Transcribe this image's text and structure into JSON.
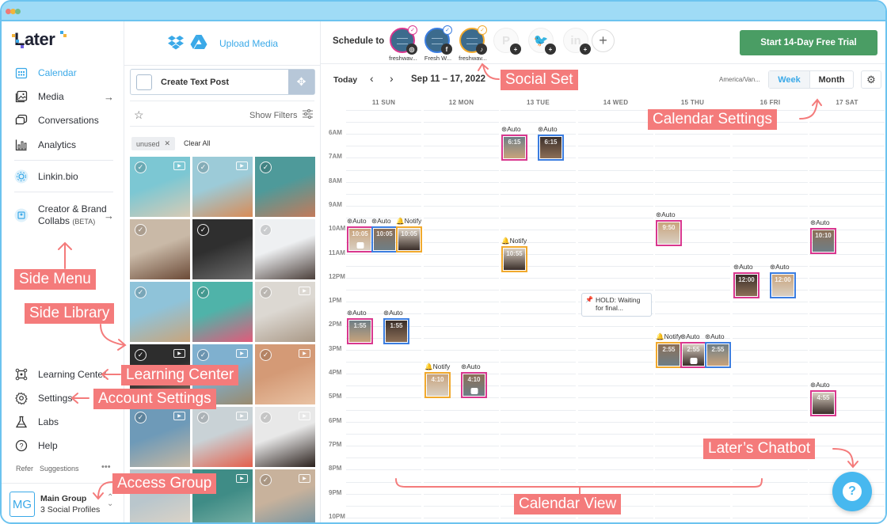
{
  "app": {
    "logo_text": "Later"
  },
  "sidebar": {
    "items": [
      {
        "label": "Calendar",
        "icon": "calendar-icon",
        "active": true
      },
      {
        "label": "Media",
        "icon": "media-icon",
        "arrow": "→"
      },
      {
        "label": "Conversations",
        "icon": "conversations-icon"
      },
      {
        "label": "Analytics",
        "icon": "analytics-icon"
      },
      {
        "label": "Linkin.bio",
        "icon": "linkinbio-icon"
      },
      {
        "label": "Creator & Brand",
        "label2": "Collabs",
        "badge": "(BETA)",
        "icon": "collabs-icon",
        "arrow": "→"
      }
    ],
    "bottom_items": [
      {
        "label": "Learning Center",
        "icon": "learning-center-icon"
      },
      {
        "label": "Settings",
        "icon": "settings-icon"
      },
      {
        "label": "Labs",
        "icon": "labs-icon"
      },
      {
        "label": "Help",
        "icon": "help-icon"
      }
    ],
    "refer": "Refer",
    "suggestions": "Suggestions",
    "more": "•••",
    "group": {
      "initials": "MG",
      "name": "Main Group",
      "profiles": "3 Social Profiles"
    }
  },
  "library": {
    "upload_label": "Upload Media",
    "create_text_post": "Create Text Post",
    "show_filters": "Show Filters",
    "filter_chip": "unused",
    "clear_all": "Clear All",
    "thumbnails": [
      {
        "video": true,
        "colors": [
          "#7cc7d3",
          "#d8cbb5"
        ]
      },
      {
        "video": true,
        "colors": [
          "#9ccbd8",
          "#d98b56"
        ]
      },
      {
        "video": false,
        "colors": [
          "#4e9a9a",
          "#c47a5a"
        ]
      },
      {
        "video": false,
        "colors": [
          "#c9b9a7",
          "#6b4a37"
        ]
      },
      {
        "video": false,
        "colors": [
          "#2f2f2f",
          "#6d6d6d"
        ]
      },
      {
        "video": false,
        "colors": [
          "#eef0f2",
          "#4b3f3a"
        ]
      },
      {
        "video": false,
        "colors": [
          "#8fc3d9",
          "#c9a57c"
        ]
      },
      {
        "video": false,
        "colors": [
          "#4fb3a9",
          "#e25a7a"
        ]
      },
      {
        "video": true,
        "colors": [
          "#dcd8d2",
          "#a99886"
        ]
      },
      {
        "video": true,
        "colors": [
          "#2d2d2d",
          "#8c7566"
        ]
      },
      {
        "video": true,
        "colors": [
          "#7fb0cf",
          "#9a8a6d"
        ]
      },
      {
        "video": true,
        "colors": [
          "#d49a76",
          "#e9c2a3"
        ]
      },
      {
        "video": true,
        "colors": [
          "#6e9ab8",
          "#c5b7a3"
        ]
      },
      {
        "video": true,
        "colors": [
          "#c9d2d6",
          "#e45f4b"
        ]
      },
      {
        "video": true,
        "colors": [
          "#e8e8e8",
          "#2a201c"
        ]
      },
      {
        "video": true,
        "colors": [
          "#b9c6cc",
          "#e0d5c6"
        ]
      },
      {
        "video": true,
        "colors": [
          "#3f8c86",
          "#7fb4a7"
        ]
      },
      {
        "video": true,
        "colors": [
          "#c8b29c",
          "#6a8fa0"
        ]
      }
    ]
  },
  "topbar": {
    "schedule_to": "Schedule to",
    "profiles": [
      {
        "name": "freshwav...",
        "network": "instagram",
        "color": "#d9378e",
        "connected": true
      },
      {
        "name": "Fresh W...",
        "network": "facebook",
        "color": "#3b7de0",
        "connected": true
      },
      {
        "name": "freshwav...",
        "network": "tiktok",
        "color": "#f1a92d",
        "connected": true
      },
      {
        "name": "",
        "network": "pinterest",
        "connected": false
      },
      {
        "name": "",
        "network": "twitter",
        "connected": false
      },
      {
        "name": "",
        "network": "linkedin",
        "connected": false
      }
    ],
    "trial_button": "Start 14-Day Free Trial"
  },
  "calendar": {
    "today": "Today",
    "range": "Sep 11 – 17, 2022",
    "timezone": "America/Van...",
    "view_week": "Week",
    "view_month": "Month",
    "active_view": "Week",
    "days": [
      "11 SUN",
      "12 MON",
      "13 TUE",
      "14 WED",
      "15 THU",
      "16 FRI",
      "17 SAT"
    ],
    "hours": [
      "6AM",
      "7AM",
      "8AM",
      "9AM",
      "10AM",
      "11AM",
      "12PM",
      "1PM",
      "2PM",
      "3PM",
      "4PM",
      "5PM",
      "6PM",
      "7PM",
      "8PM",
      "9PM",
      "10PM"
    ],
    "events": [
      {
        "day": 0,
        "time": "10:05",
        "mode": "Auto",
        "network": "instagram",
        "reel": true
      },
      {
        "day": 0,
        "time": "10:05",
        "mode": "Auto",
        "network": "facebook"
      },
      {
        "day": 0,
        "time": "10:05",
        "mode": "Notify",
        "network": "tiktok"
      },
      {
        "day": 0,
        "time": "1:55",
        "mode": "Auto",
        "network": "instagram"
      },
      {
        "day": 0,
        "time": "1:55",
        "mode": "Auto",
        "network": "facebook"
      },
      {
        "day": 1,
        "time": "4:10",
        "mode": "Notify",
        "network": "tiktok"
      },
      {
        "day": 1,
        "time": "4:10",
        "mode": "Auto",
        "network": "instagram",
        "reel": true
      },
      {
        "day": 2,
        "time": "10:55",
        "mode": "Notify",
        "network": "tiktok"
      },
      {
        "day": 2,
        "time": "6:15",
        "mode": "Auto",
        "network": "instagram"
      },
      {
        "day": 2,
        "time": "6:15",
        "mode": "Auto",
        "network": "facebook"
      },
      {
        "day": 4,
        "time": "9:50",
        "mode": "Auto",
        "network": "instagram"
      },
      {
        "day": 4,
        "time": "2:55",
        "mode": "Notify",
        "network": "tiktok"
      },
      {
        "day": 4,
        "time": "2:55",
        "mode": "Auto",
        "network": "instagram",
        "reel": true
      },
      {
        "day": 4,
        "time": "2:55",
        "mode": "Auto",
        "network": "facebook"
      },
      {
        "day": 5,
        "time": "12:00",
        "mode": "Auto",
        "network": "instagram"
      },
      {
        "day": 5,
        "time": "12:00",
        "mode": "Auto",
        "network": "facebook"
      },
      {
        "day": 6,
        "time": "10:10",
        "mode": "Auto",
        "network": "instagram"
      },
      {
        "day": 6,
        "time": "4:55",
        "mode": "Auto",
        "network": "instagram"
      }
    ],
    "hold_note": {
      "day": 3,
      "line1": "HOLD: Waiting",
      "line2": "for final..."
    }
  },
  "annotations": {
    "side_menu": "Side Menu",
    "side_library": "Side Library",
    "learning_center": "Learning Center",
    "account_settings": "Account Settings",
    "access_group": "Access Group",
    "social_set": "Social Set",
    "calendar_settings": "Calendar Settings",
    "chatbot": "Later’s Chatbot",
    "calendar_view": "Calendar View"
  },
  "colors": {
    "accent": "#3aa9e8",
    "trial_green": "#4a9d64",
    "annotation": "#f47b7b",
    "instagram": "#d9378e",
    "facebook": "#3b7de0",
    "tiktok": "#f1a92d"
  }
}
